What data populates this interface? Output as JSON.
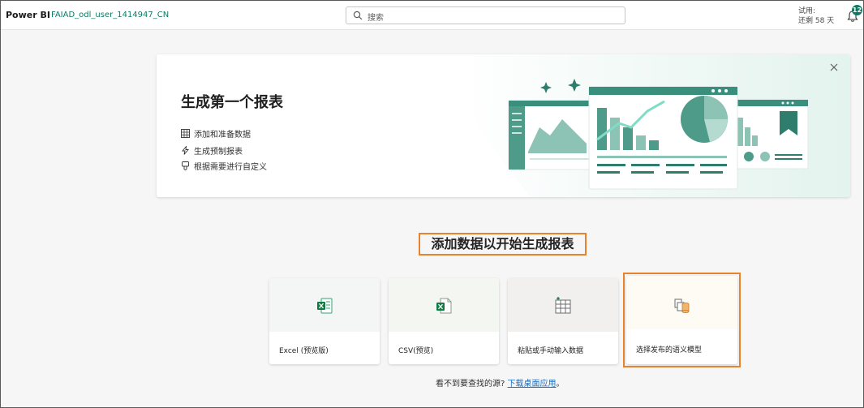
{
  "header": {
    "brand": "Power BI",
    "workspace": "FAIAD_odl_user_1414947_CN",
    "search_placeholder": "搜索",
    "trial_line1": "试用:",
    "trial_line2": "还剩 58 天",
    "notification_count": "12"
  },
  "hero": {
    "title": "生成第一个报表",
    "features": [
      {
        "label": "添加和准备数据",
        "icon": "table-icon"
      },
      {
        "label": "生成预制报表",
        "icon": "lightning-icon"
      },
      {
        "label": "根据需要进行自定义",
        "icon": "customize-icon"
      }
    ]
  },
  "section": {
    "heading": "添加数据以开始生成报表"
  },
  "cards": [
    {
      "label": "Excel (预览版)",
      "icon": "excel-icon"
    },
    {
      "label": "CSV(预览)",
      "icon": "csv-icon"
    },
    {
      "label": "粘贴或手动输入数据",
      "icon": "table-grid-icon"
    },
    {
      "label": "选择发布的语义模型",
      "icon": "semantic-model-icon"
    }
  ],
  "footer": {
    "text": "看不到要查找的源?",
    "link": "下载桌面应用",
    "end": "。"
  },
  "colors": {
    "accent": "#117865",
    "highlight": "#e8822d",
    "link": "#1b6ec2"
  }
}
